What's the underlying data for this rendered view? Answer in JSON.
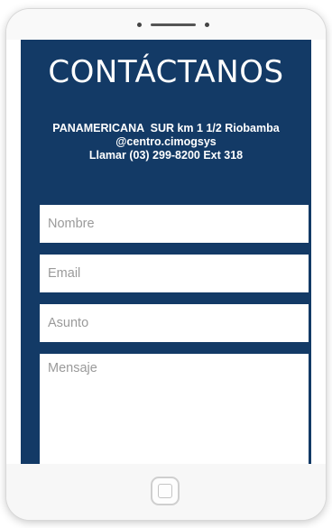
{
  "contact": {
    "title": "CONTÁCTANOS",
    "address_line": "PANAMERICANA  SUR km 1 1/2 Riobamba",
    "social_handle": "@centro.cimogsys",
    "phone_line": "Llamar (03) 299-8200 Ext 318"
  },
  "form": {
    "name_placeholder": "Nombre",
    "email_placeholder": "Email",
    "subject_placeholder": "Asunto",
    "message_placeholder": "Mensaje"
  },
  "colors": {
    "screen_background": "#133a66",
    "field_background": "#ffffff",
    "title_text": "#ffffff"
  }
}
